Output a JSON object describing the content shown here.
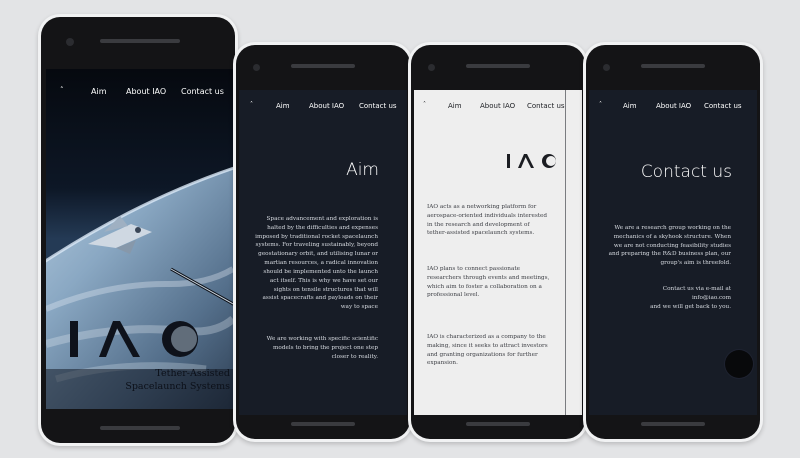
{
  "nav": {
    "home": "˄",
    "aim": "Aim",
    "about": "About IAO",
    "contact": "Contact us"
  },
  "hero": {
    "logo_text": "IAO",
    "tagline_line1": "Tether-Assisted",
    "tagline_line2": "Spacelaunch Systems"
  },
  "aim_page": {
    "heading": "Aim",
    "paragraph1": "Space advancement and exploration is\nhalted by the difficulties and expenses\nimposed by traditional rocket spacelaunch\nsystems. For traveling sustainably, beyond\ngeostationary orbit, and utilising lunar or\nmartian resources, a radical innovation\nshould be implemented unto the launch\nact itself. This is why we have set our\nsights on tensile structures that will\nassist spacecrafts and payloads on their\nway to space",
    "paragraph2": "We are working with specific scientific\nmodels to bring the project one step\ncloser to reality."
  },
  "about_page": {
    "paragraph1": "IAO acts as a networking platform for\naerospace-oriented individuals interested\nin the research and development of\ntether-assisted spacelaunch systems.",
    "paragraph2": "IAO plans to connect passionate\nresearchers through events and meetings,\nwhich aim to foster a collaboration on a\nprofessional level.",
    "paragraph3": "IAO is characterized as a company to the\nmaking, since it seeks to attract investors\nand granting organizations for further\nexpansion."
  },
  "contact_page": {
    "heading": "Contact us",
    "paragraph1": "We are a research group working on the\nmechanics of a skyhook structure. When\nwe are not conducting feasibility studies\nand preparing the R&D business plan, our\ngroup's aim is threefold.",
    "paragraph2": "Contact us via e-mail at\ninfo@iao.com\nand we will get back to you."
  },
  "colors": {
    "page_bg": "#e3e4e6",
    "phone_frame": "#f1f2f3",
    "dark_screen": "#171c26",
    "light_screen": "#eeeeee"
  }
}
